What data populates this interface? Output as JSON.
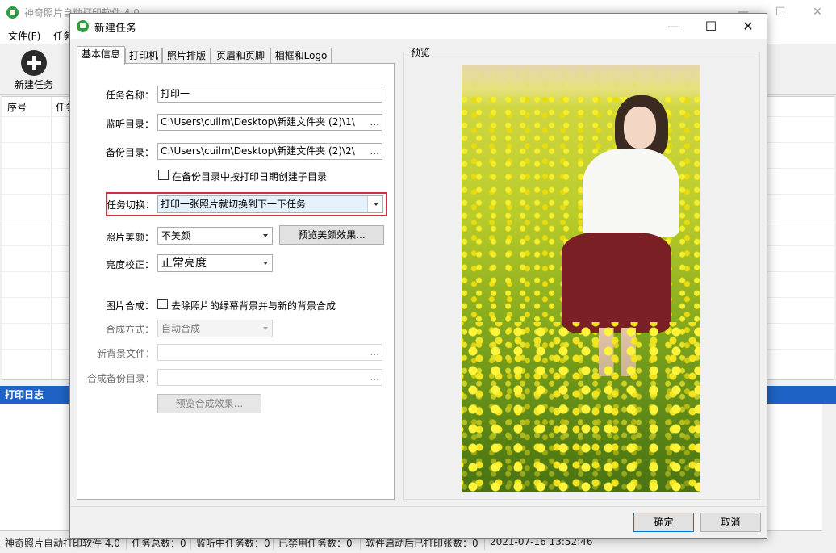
{
  "main_window": {
    "title": "神奇照片自动打印软件 4.0",
    "menu": [
      "文件(F)",
      "任务"
    ],
    "toolbar": {
      "new_task_label": "新建任务"
    },
    "table_headers": [
      "序号",
      "任务"
    ],
    "log_title": "打印日志",
    "status_bar": [
      "神奇照片自动打印软件 4.0",
      "任务总数：0",
      "监听中任务数：0",
      "已禁用任务数：0",
      "软件启动后已打印张数：0",
      "2021-07-16 13:52:46"
    ]
  },
  "dialog": {
    "title": "新建任务",
    "tabs": [
      "基本信息",
      "打印机",
      "照片排版",
      "页眉和页脚",
      "相框和Logo"
    ],
    "active_tab": "基本信息",
    "form": {
      "task_name_label": "任务名称：",
      "task_name_value": "打印一",
      "watch_dir_label": "监听目录：",
      "watch_dir_value": "C:\\Users\\cuilm\\Desktop\\新建文件夹 (2)\\1\\",
      "backup_dir_label": "备份目录：",
      "backup_dir_value": "C:\\Users\\cuilm\\Desktop\\新建文件夹 (2)\\2\\",
      "browse_label": "...",
      "date_subdir_label": "在备份目录中按打印日期创建子目录",
      "date_subdir_checked": false,
      "switch_label": "任务切换：",
      "switch_value": "打印一张照片就切换到下一下任务",
      "beauty_label": "照片美颜：",
      "beauty_value": "不美颜",
      "preview_beauty_button": "预览美颜效果...",
      "brightness_label": "亮度校正：",
      "brightness_value": "正常亮度",
      "compose_label": "图片合成：",
      "compose_checkbox_label": "去除照片的绿幕背景并与新的背景合成",
      "compose_checked": false,
      "compose_mode_label": "合成方式：",
      "compose_mode_value": "自动合成",
      "new_bg_label": "新背景文件：",
      "new_bg_value": "",
      "compose_backup_label": "合成备份目录：",
      "compose_backup_value": "",
      "preview_compose_button": "预览合成效果..."
    },
    "preview_label": "预览",
    "ok_button": "确定",
    "cancel_button": "取消",
    "highlight_color": "#d32f3f"
  }
}
